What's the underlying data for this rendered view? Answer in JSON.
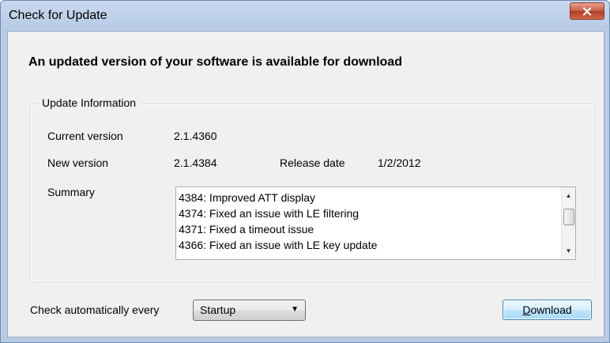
{
  "window": {
    "title": "Check for Update",
    "close_icon": "close-icon"
  },
  "headline": "An updated version of your software is available for download",
  "update_info": {
    "legend": "Update Information",
    "current_version_label": "Current version",
    "current_version_value": "2.1.4360",
    "new_version_label": "New version",
    "new_version_value": "2.1.4384",
    "release_date_label": "Release date",
    "release_date_value": "1/2/2012",
    "summary_label": "Summary",
    "summary_lines": [
      "4384: Improved ATT display",
      "4374: Fixed an issue with LE filtering",
      "4371: Fixed a timeout issue",
      "4366: Fixed an issue with LE key update"
    ]
  },
  "footer": {
    "check_label": "Check automatically every",
    "interval_selected": "Startup",
    "download_mnemonic": "D",
    "download_rest": "ownload"
  },
  "colors": {
    "close_button": "#c75c45",
    "title_gradient": "#c9d9ee",
    "default_button_border": "#3c7fb1"
  }
}
